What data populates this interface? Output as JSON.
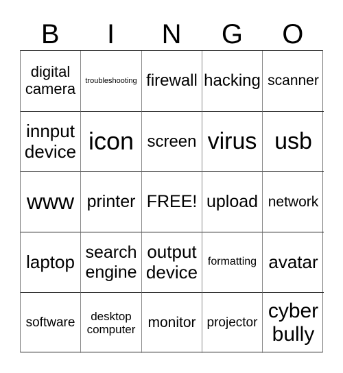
{
  "header": {
    "letters": [
      "B",
      "I",
      "N",
      "G",
      "O"
    ]
  },
  "cells": [
    {
      "text": "digital\ncamera",
      "size": 22
    },
    {
      "text": "troubleshooting",
      "size": 11
    },
    {
      "text": "firewall",
      "size": 24
    },
    {
      "text": "hacking",
      "size": 24
    },
    {
      "text": "scanner",
      "size": 21
    },
    {
      "text": "innput\ndevice",
      "size": 26
    },
    {
      "text": "icon",
      "size": 36
    },
    {
      "text": "screen",
      "size": 24
    },
    {
      "text": "virus",
      "size": 34
    },
    {
      "text": "usb",
      "size": 34
    },
    {
      "text": "www",
      "size": 32
    },
    {
      "text": "printer",
      "size": 25
    },
    {
      "text": "FREE!",
      "size": 25
    },
    {
      "text": "upload",
      "size": 25
    },
    {
      "text": "network",
      "size": 21
    },
    {
      "text": "laptop",
      "size": 26
    },
    {
      "text": "search\nengine",
      "size": 25
    },
    {
      "text": "output\ndevice",
      "size": 26
    },
    {
      "text": "formatting",
      "size": 16
    },
    {
      "text": "avatar",
      "size": 26
    },
    {
      "text": "software",
      "size": 19
    },
    {
      "text": "desktop\ncomputer",
      "size": 17
    },
    {
      "text": "monitor",
      "size": 21
    },
    {
      "text": "projector",
      "size": 19
    },
    {
      "text": "cyber\nbully",
      "size": 30
    }
  ]
}
